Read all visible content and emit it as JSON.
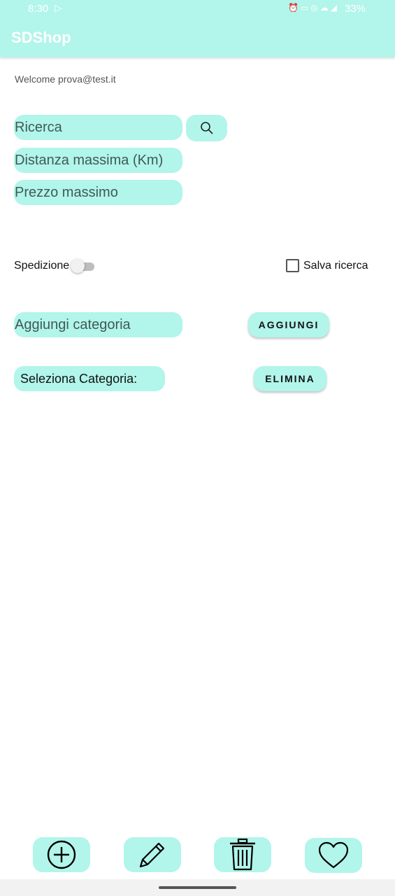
{
  "status_bar": {
    "time": "8:30",
    "battery": "33%",
    "icons": [
      "play-store-icon",
      "alarm-icon",
      "nfc-icon",
      "hotspot-icon",
      "cloud-icon",
      "wifi-icon",
      "signal-icon"
    ]
  },
  "app_bar": {
    "title": "SDShop"
  },
  "welcome": "Welcome prova@test.it",
  "search": {
    "query_placeholder": "Ricerca",
    "distance_placeholder": "Distanza massima (Km)",
    "price_placeholder": "Prezzo massimo"
  },
  "options": {
    "shipping_label": "Spedizione",
    "shipping_on": false,
    "save_search_label": "Salva ricerca",
    "save_search_checked": false
  },
  "category": {
    "add_placeholder": "Aggiungi categoria",
    "add_button": "AGGIUNGI",
    "select_label": "Seleziona Categoria:",
    "delete_button": "ELIMINA"
  },
  "bottom_nav": [
    "add-circle-icon",
    "pencil-icon",
    "trash-icon",
    "heart-icon"
  ],
  "colors": {
    "accent": "#b2f5ea"
  }
}
